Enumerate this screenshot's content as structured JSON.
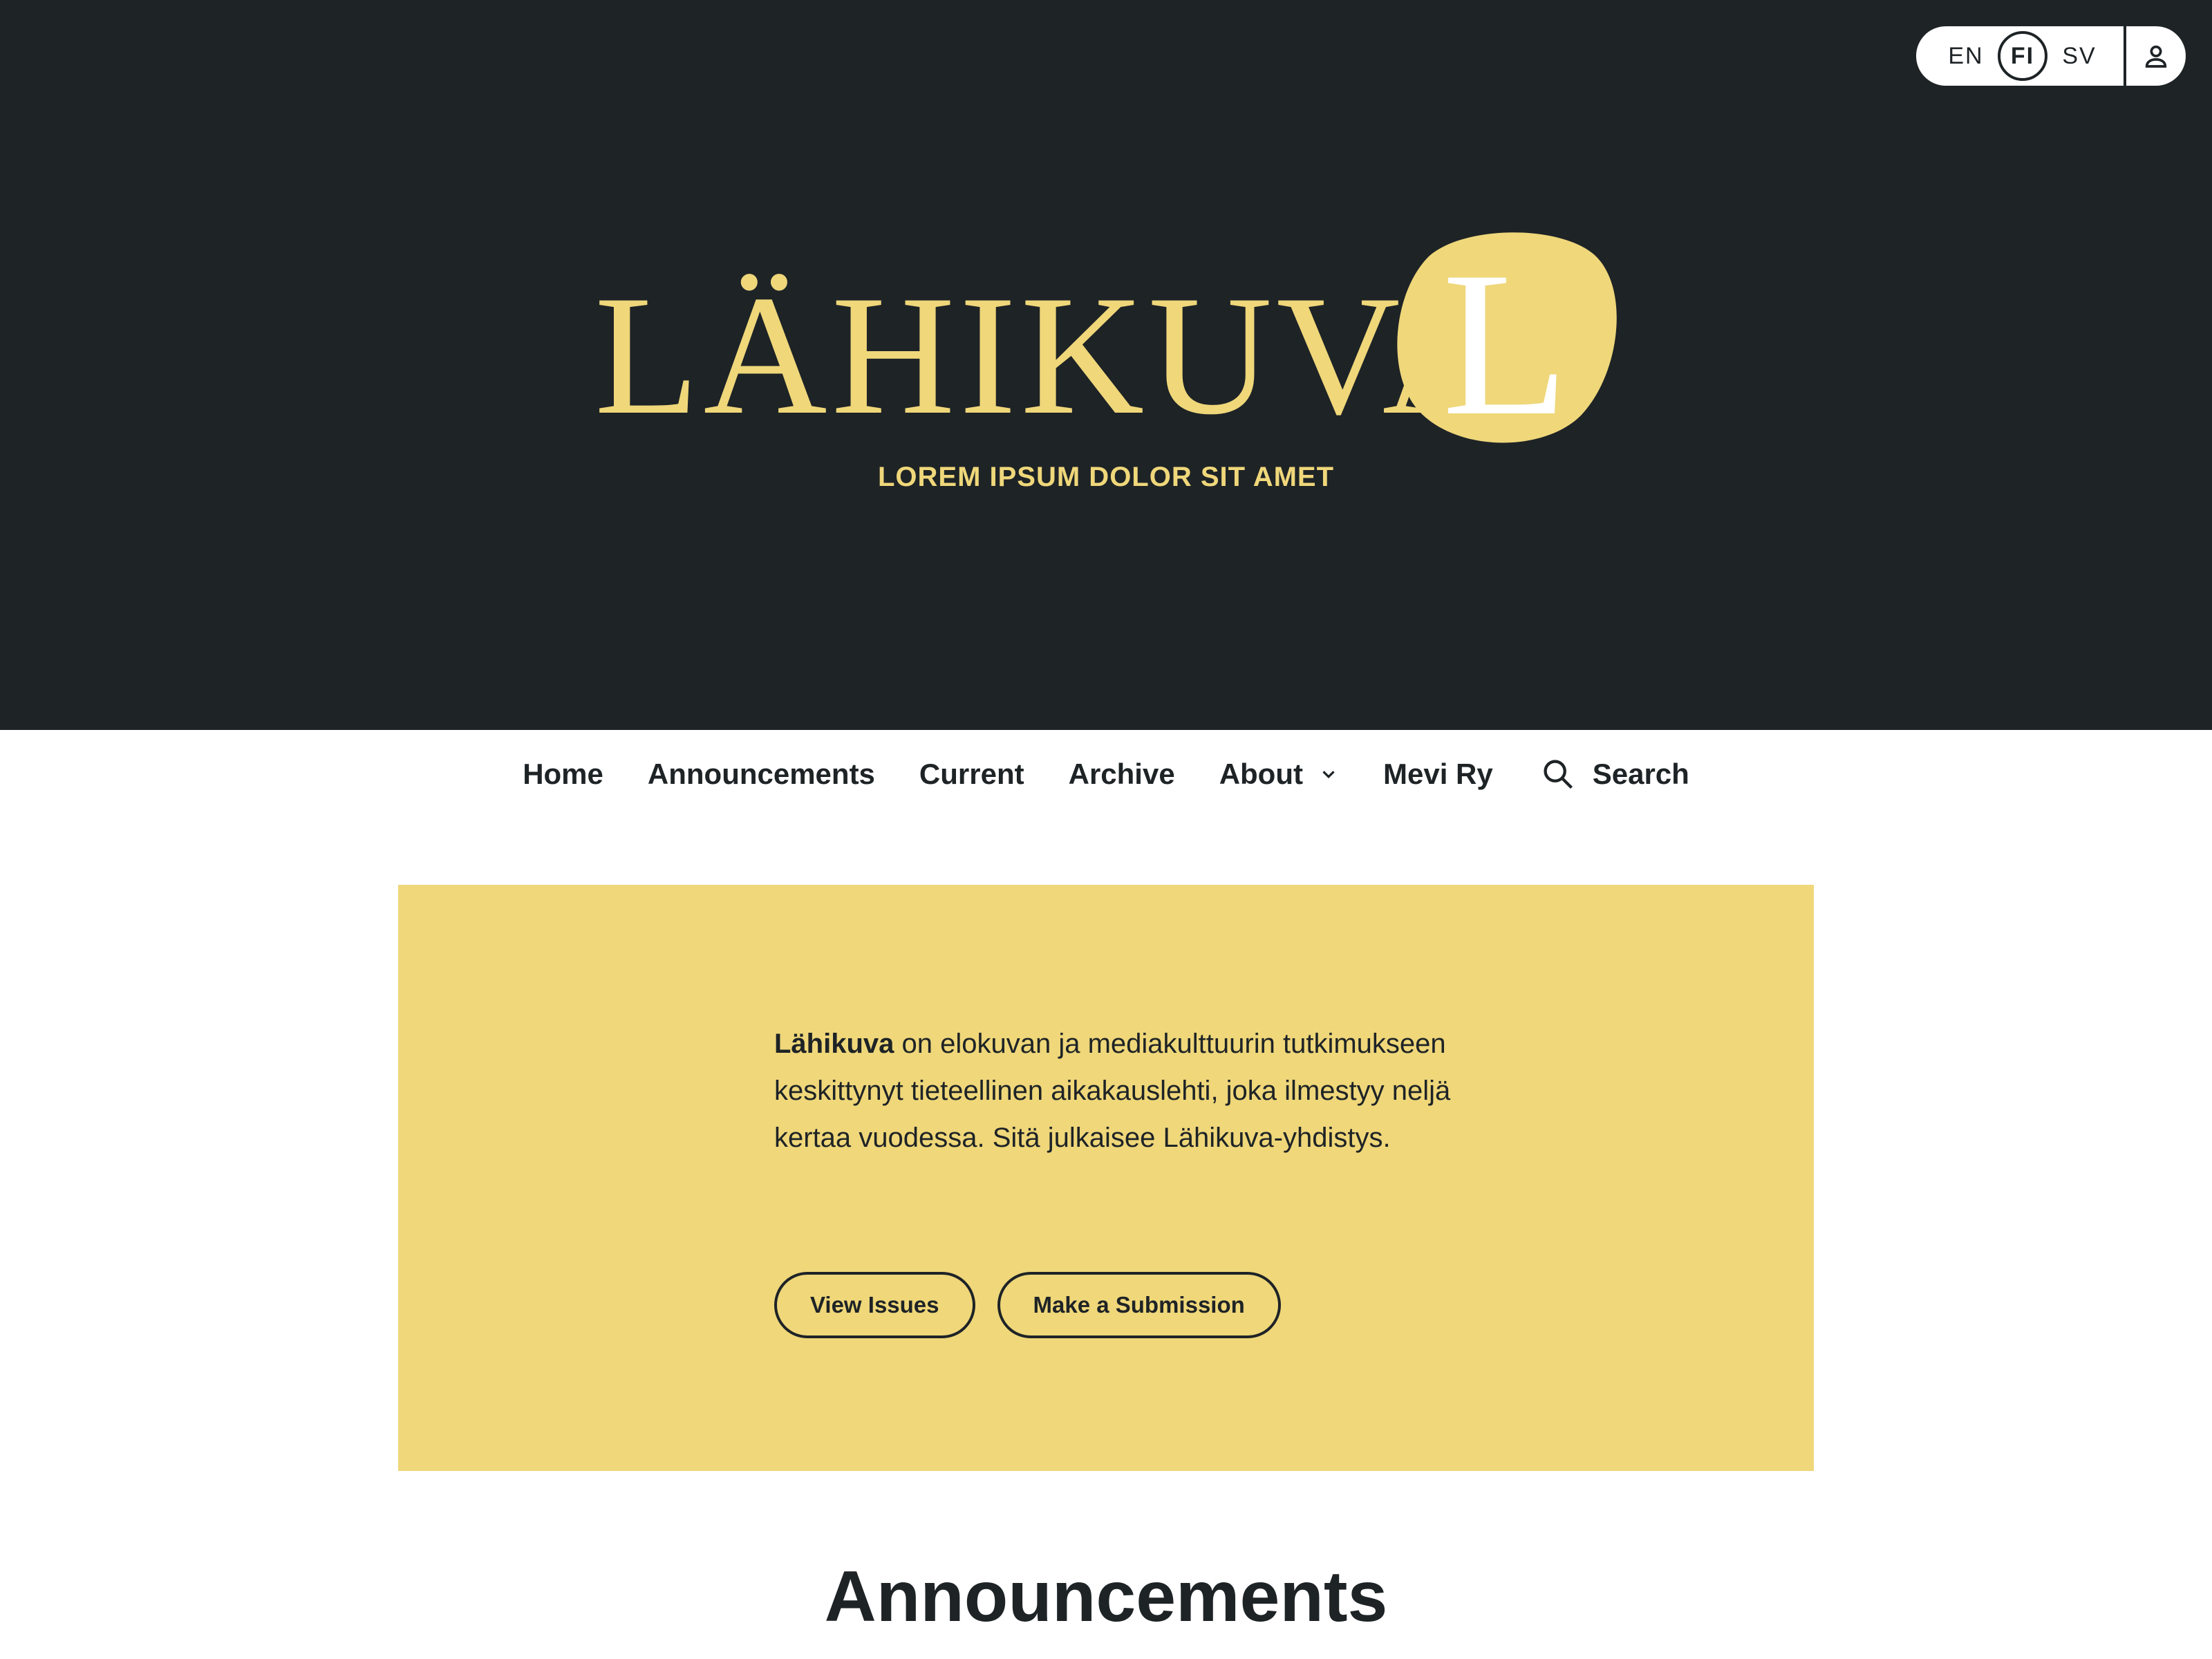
{
  "colors": {
    "header_bg": "#1e2326",
    "brand_yellow": "#efd77a",
    "text_dark": "#1e2326",
    "page_bg": "#ffffff"
  },
  "language_switcher": {
    "items": [
      {
        "label": "EN",
        "active": false
      },
      {
        "label": "FI",
        "active": true
      },
      {
        "label": "SV",
        "active": false
      }
    ],
    "user_icon": "user-icon"
  },
  "header": {
    "logo_text": "LÄHIKUVA",
    "logo_mark_letter": "L",
    "tagline": "LOREM IPSUM DOLOR SIT AMET"
  },
  "nav": {
    "items": [
      {
        "label": "Home"
      },
      {
        "label": "Announcements"
      },
      {
        "label": "Current"
      },
      {
        "label": "Archive"
      },
      {
        "label": "About",
        "has_dropdown": true,
        "icon": "chevron-down-icon"
      },
      {
        "label": "Mevi Ry"
      }
    ],
    "search": {
      "label": "Search",
      "icon": "search-icon"
    }
  },
  "hero": {
    "bold_lead": "Lähikuva",
    "text": " on elokuvan ja mediakulttuurin tutkimukseen keskittynyt tieteellinen aikakauslehti, joka ilmestyy neljä kertaa vuodessa. Sitä julkaisee Lähikuva-yhdistys.",
    "buttons": [
      {
        "label": "View Issues"
      },
      {
        "label": "Make a Submission"
      }
    ]
  },
  "announcements": {
    "title": "Announcements"
  }
}
